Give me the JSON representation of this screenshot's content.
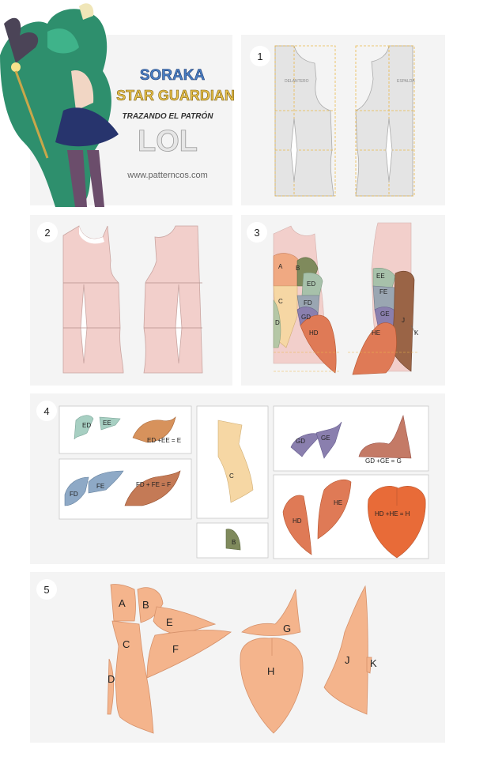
{
  "header": {
    "line1": "SORAKA",
    "line2": "STAR GUARDIAN",
    "line3": "TRAZANDO EL PATRÓN",
    "line4": "LOL",
    "website": "www.patterncos.com"
  },
  "steps": {
    "s1": "1",
    "s2": "2",
    "s3": "3",
    "s4": "4",
    "s5": "5"
  },
  "step1": {
    "front_label": "DELANTERO",
    "back_label": "ESPALDA"
  },
  "step3": {
    "front": [
      "A",
      "B",
      "ED",
      "C",
      "FD",
      "D",
      "GD",
      "HD"
    ],
    "back": [
      "EE",
      "FE",
      "GE",
      "J",
      "HE",
      "K"
    ]
  },
  "step4": {
    "ed": "ED",
    "ee": "EE",
    "e_sum": "ED +EE = E",
    "fd": "FD",
    "fe": "FE",
    "f_sum": "FD + FE = F",
    "c": "C",
    "b": "B",
    "gd": "GD",
    "ge": "GE",
    "g_sum": "GD +GE = G",
    "hd": "HD",
    "he": "HE",
    "h_sum": "HD +HE = H"
  },
  "step5": [
    "A",
    "B",
    "C",
    "D",
    "E",
    "F",
    "G",
    "H",
    "J",
    "K"
  ],
  "colors": {
    "panel": "#f4f4f4",
    "bodice_pink": "#f2cfcb",
    "final_peach": "#f4b48c",
    "title_blue": "#4a7fc4",
    "title_gold": "#e8c24a"
  }
}
